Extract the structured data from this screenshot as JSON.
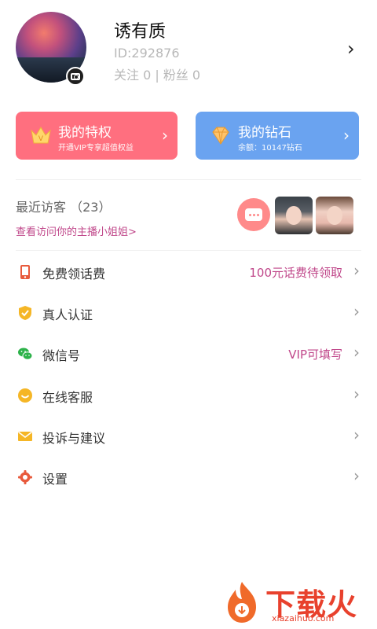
{
  "profile": {
    "name": "诱有质",
    "id_text": "ID:292876",
    "follow_text": "关注 0 | 粉丝 0",
    "chevron": "›"
  },
  "cards": {
    "privilege": {
      "title": "我的特权",
      "subtitle": "开通VIP专享超值权益",
      "chevron": "›"
    },
    "diamond": {
      "title": "我的钻石",
      "subtitle": "余额：10147钻石",
      "chevron": "›"
    }
  },
  "visitors": {
    "title": "最近访客 （23）",
    "link": "查看访问你的主播小姐姐>"
  },
  "menu": [
    {
      "label": "免费领话费",
      "value": "100元话费待领取",
      "icon": "phone-icon"
    },
    {
      "label": "真人认证",
      "value": "",
      "icon": "shield-check-icon"
    },
    {
      "label": "微信号",
      "value": "VIP可填写",
      "icon": "wechat-icon"
    },
    {
      "label": "在线客服",
      "value": "",
      "icon": "smile-icon"
    },
    {
      "label": "投诉与建议",
      "value": "",
      "icon": "envelope-icon"
    },
    {
      "label": "设置",
      "value": "",
      "icon": "gear-icon"
    }
  ],
  "chevron": "›",
  "watermark": {
    "big": "下载火",
    "small": "xiazaihuo.com"
  },
  "colors": {
    "privilege": "#ff6f7f",
    "diamond": "#6aa3f0",
    "accent": "#c0478a"
  }
}
